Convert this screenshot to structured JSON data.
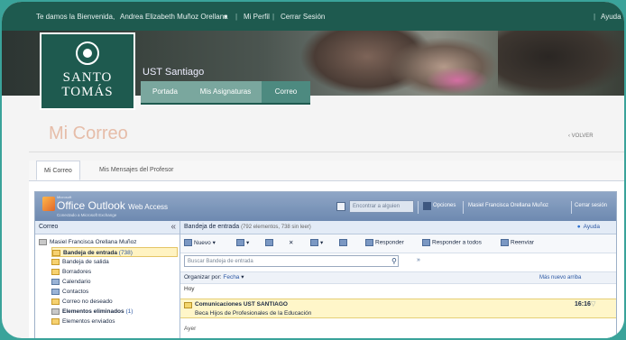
{
  "topbar": {
    "welcome": "Te damos la Bienvenida,",
    "user_name": "Andrea Elizabeth Muñoz Orellana",
    "profile": "Mi Perfil",
    "logout": "Cerrar Sesión",
    "help": "Ayuda"
  },
  "brand": {
    "logo_line1": "SANTO",
    "logo_line2": "TOMÁS",
    "campus": "UST Santiago"
  },
  "nav": {
    "tabs": [
      {
        "label": "Portada"
      },
      {
        "label": "Mis Asignaturas"
      },
      {
        "label": "Correo"
      }
    ]
  },
  "page": {
    "title": "Mi Correo",
    "back": "VOLVER"
  },
  "content_tabs": [
    {
      "label": "Mi Correo"
    },
    {
      "label": "Mis Mensajes del Profesor"
    }
  ],
  "owa": {
    "ms_small": "Microsoft",
    "app_title": "Office Outlook",
    "app_title_small": "Web Access",
    "subtitle": "Conectado a Microsoft Exchange",
    "find_placeholder": "Encontrar a alguien",
    "options": "Opciones",
    "user": "Masiel Francisca Orellana Muñoz",
    "logout": "Cerrar sesión",
    "left_title": "Correo",
    "tree": [
      {
        "label": "Masiel Francisca Orellana Muñoz",
        "count": ""
      },
      {
        "label": "Bandeja de entrada",
        "count": "(738)"
      },
      {
        "label": "Bandeja de salida",
        "count": ""
      },
      {
        "label": "Borradores",
        "count": ""
      },
      {
        "label": "Calendario",
        "count": ""
      },
      {
        "label": "Contactos",
        "count": ""
      },
      {
        "label": "Correo no deseado",
        "count": ""
      },
      {
        "label": "Elementos eliminados",
        "count": "(1)"
      },
      {
        "label": "Elementos enviados",
        "count": ""
      }
    ],
    "inbox_title": "Bandeja de entrada",
    "inbox_meta": "(792 elementos, 738 sin leer)",
    "help": "Ayuda",
    "toolbar": {
      "new": "Nuevo",
      "reply": "Responder",
      "reply_all": "Responder a todos",
      "forward": "Reenviar"
    },
    "search_placeholder": "Buscar Bandeja de entrada",
    "organize_label": "Organizar por:",
    "organize_field": "Fecha",
    "order": "Más nuevo arriba",
    "group_today": "Hoy",
    "group_earlier": "Ayer",
    "messages": [
      {
        "from": "Comunicaciones UST SANTIAGO",
        "subject": "Beca Hijos de Profesionales de la Educación",
        "time": "16:16"
      }
    ]
  }
}
